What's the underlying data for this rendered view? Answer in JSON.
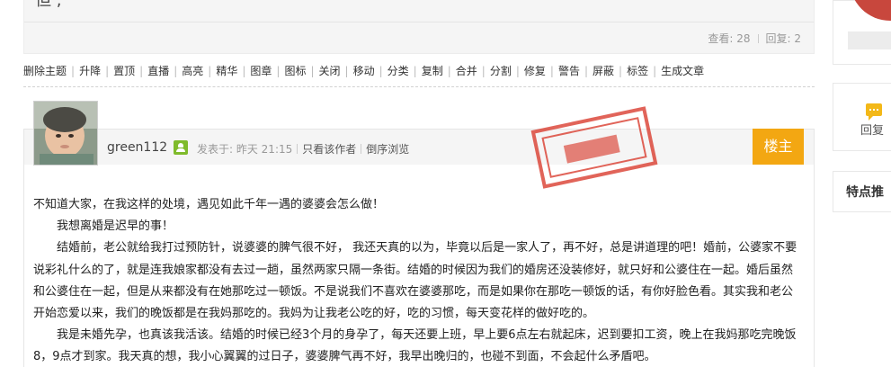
{
  "thread": {
    "title_fragment": "但  ,",
    "views_label": "查看: 28",
    "replies_label": "回复: 2"
  },
  "admin_toolbar": {
    "items": [
      "删除主题",
      "升降",
      "置顶",
      "直播",
      "高亮",
      "精华",
      "图章",
      "图标",
      "关闭",
      "移动",
      "分类",
      "复制",
      "合并",
      "分割",
      "修复",
      "警告",
      "屏蔽",
      "标签",
      "生成文章"
    ]
  },
  "sidebar": {
    "reply_label": "回复",
    "feature_label": "特点推"
  },
  "post": {
    "username": "green112",
    "posted_label": "发表于: 昨天 21:15",
    "only_author": "只看该作者",
    "reverse_browse": "倒序浏览",
    "floor_label": "楼主",
    "paragraphs": [
      "不知道大家，在我这样的处境，遇见如此千年一遇的婆婆会怎么做！",
      "我想离婚是迟早的事！",
      "结婚前，老公就给我打过预防针，说婆婆的脾气很不好， 我还天真的以为，毕竟以后是一家人了，再不好，总是讲道理的吧！婚前，公婆家不要说彩礼什么的了，就是连我娘家都没有去过一趟，虽然两家只隔一条街。结婚的时候因为我们的婚房还没装修好，就只好和公婆住在一起。婚后虽然和公婆住在一起，但是从来都没有在她那吃过一顿饭。不是说我们不喜欢在婆婆那吃，而是如果你在那吃一顿饭的话，有你好脸色看。其实我和老公开始恋爱以来，我们的晚饭都是在我妈那吃的。我妈为让我老公吃的好，吃的习惯，每天变花样的做好吃的。",
      "我是未婚先孕，也真该我活该。结婚的时候已经3个月的身孕了，每天还要上班，早上要6点左右就起床，迟到要扣工资，晚上在我妈那吃完晚饭8，9点才到家。我天真的想，我小心翼翼的过日子，婆婆脾气再不好，我早出晚归的，也碰不到面，不会起什么矛盾吧。"
    ]
  },
  "colors": {
    "floor_badge": "#f3a712",
    "stamp_red": "#d9392b",
    "user_icon": "#7fbb2b"
  }
}
